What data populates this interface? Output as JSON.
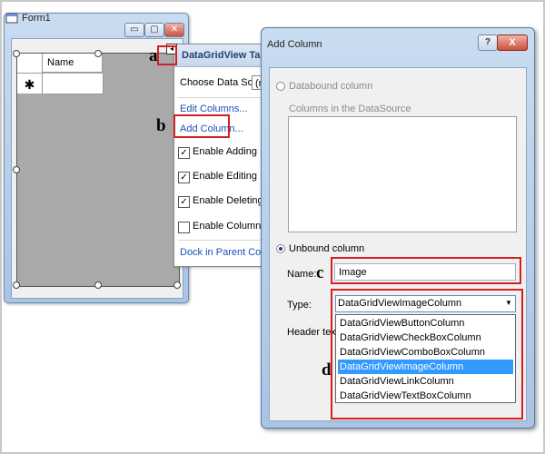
{
  "form1": {
    "title": "Form1",
    "controls": {
      "minimize": "▭",
      "maximize": "▢",
      "close": "✕"
    },
    "grid": {
      "column_header": "Name",
      "new_row_marker": "✱"
    },
    "smart_tag": "◂"
  },
  "callouts": {
    "a": "a",
    "b": "b",
    "c": "c",
    "d": "d"
  },
  "tasks": {
    "title": "DataGridView Tasks",
    "choose_data_source_label": "Choose Data Source:",
    "data_source_value": "(no",
    "edit_columns": "Edit Columns...",
    "add_column": "Add Column...",
    "checkboxes": [
      {
        "label": "Enable Adding",
        "checked": true
      },
      {
        "label": "Enable Editing",
        "checked": true
      },
      {
        "label": "Enable Deleting",
        "checked": true
      },
      {
        "label": "Enable Column Reorde",
        "checked": false
      }
    ],
    "dock_link": "Dock in Parent Container"
  },
  "dialog": {
    "title": "Add Column",
    "help_button": "?",
    "close_button": "X",
    "databound_label": "Databound column",
    "columns_in_datasource_label": "Columns in the DataSource",
    "unbound_label": "Unbound column",
    "name_label": "Name:",
    "name_value": "Image",
    "type_label": "Type:",
    "type_value": "DataGridViewImageColumn",
    "header_text_label": "Header text:",
    "type_options": [
      "DataGridViewButtonColumn",
      "DataGridViewCheckBoxColumn",
      "DataGridViewComboBoxColumn",
      "DataGridViewImageColumn",
      "DataGridViewLinkColumn",
      "DataGridViewTextBoxColumn"
    ],
    "selected_option_index": 3
  },
  "colors": {
    "highlight": "#d42020",
    "selection": "#3399ff",
    "link": "#1a50b8"
  }
}
